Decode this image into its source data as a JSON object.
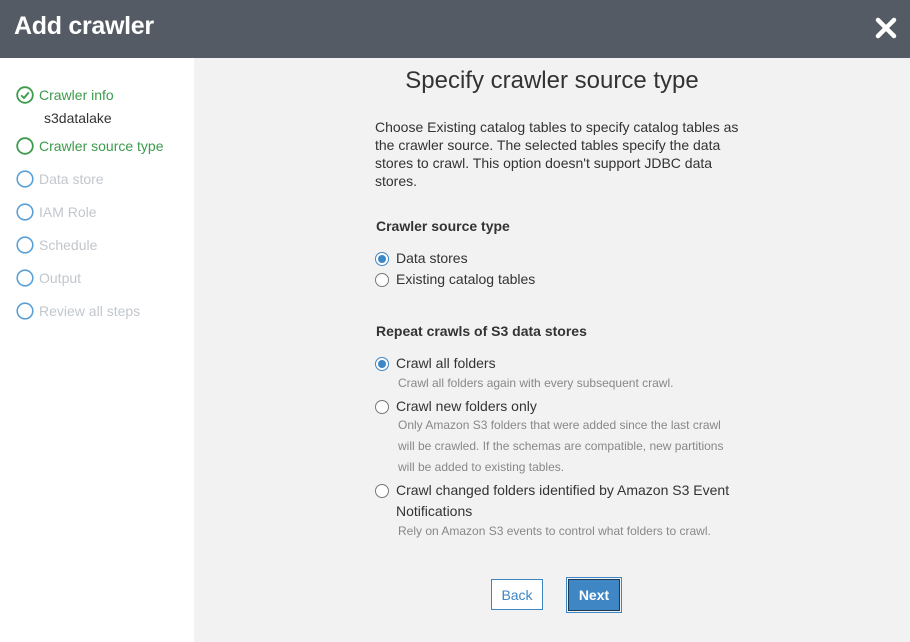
{
  "header": {
    "title": "Add crawler",
    "close_icon": "close-icon"
  },
  "sidebar": {
    "steps": [
      {
        "label": "Crawler info",
        "status": "completed",
        "sub": "s3datalake"
      },
      {
        "label": "Crawler source type",
        "status": "current"
      },
      {
        "label": "Data store",
        "status": "pending"
      },
      {
        "label": "IAM Role",
        "status": "pending"
      },
      {
        "label": "Schedule",
        "status": "pending"
      },
      {
        "label": "Output",
        "status": "pending"
      },
      {
        "label": "Review all steps",
        "status": "pending"
      }
    ]
  },
  "main": {
    "title": "Specify crawler source type",
    "description": "Choose Existing catalog tables to specify catalog tables as the crawler source. The selected tables specify the data stores to crawl. This option doesn't support JDBC data stores.",
    "source_type": {
      "heading": "Crawler source type",
      "options": [
        {
          "label": "Data stores",
          "selected": true
        },
        {
          "label": "Existing catalog tables",
          "selected": false
        }
      ]
    },
    "repeat_crawls": {
      "heading": "Repeat crawls of S3 data stores",
      "options": [
        {
          "label": "Crawl all folders",
          "selected": true,
          "help": "Crawl all folders again with every subsequent crawl."
        },
        {
          "label": "Crawl new folders only",
          "selected": false,
          "help": "Only Amazon S3 folders that were added since the last crawl will be crawled. If the schemas are compatible, new partitions will be added to existing tables."
        },
        {
          "label": "Crawl changed folders identified by Amazon S3 Event Notifications",
          "selected": false,
          "help": "Rely on Amazon S3 events to control what folders to crawl."
        }
      ]
    },
    "buttons": {
      "back": "Back",
      "next": "Next"
    }
  },
  "colors": {
    "header_bg": "#545b64",
    "accent": "#3f86c4",
    "success": "#3c9b4c",
    "pending": "#c2c7cc"
  }
}
